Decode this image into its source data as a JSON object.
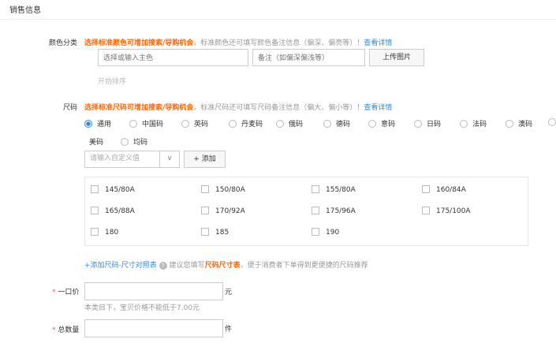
{
  "section_title": "销售信息",
  "color": {
    "label": "颜色分类",
    "hint_strong": "选择标准颜色可增加搜索/导购机会",
    "hint": "，标准颜色还可填写颜色备注信息（偏深、偏亮等）！",
    "link": "查看详情",
    "main_placeholder": "选择或输入主色",
    "note_placeholder": "备注（如偏深偏浅等）",
    "upload": "上传图片",
    "sort": "开始排序"
  },
  "size": {
    "label": "尺码",
    "hint_strong": "选择标准尺码可增加搜索/导购机会",
    "hint": "，标准尺码还可填写尺码备注信息（偏大、偏小等）！",
    "link": "查看详情",
    "systems": [
      "通用",
      "中国码",
      "英码",
      "丹麦码",
      "俄码",
      "德码",
      "意码",
      "日码",
      "法码",
      "澳码",
      "美码",
      "均码"
    ],
    "selected": "通用",
    "custom_placeholder": "请输入自定义值",
    "add": "+ 添加",
    "options": [
      "145/80A",
      "150/80A",
      "155/80A",
      "160/84A",
      "165/88A",
      "170/92A",
      "175/96A",
      "175/100A",
      "180",
      "185",
      "190"
    ],
    "chart_link": "+添加尺码-尺寸对照表",
    "chart_tip_pre": "建议您填写",
    "chart_tip_strong": "尺码尺寸表",
    "chart_tip_post": "，便于消费者下单得到更便捷的尺码推荐"
  },
  "price": {
    "required": "*",
    "label": "一口价",
    "unit": "元",
    "help": "本类目下，宝贝价格不能低于7.00元"
  },
  "quantity": {
    "required": "*",
    "label": "总数量",
    "unit": "件"
  }
}
